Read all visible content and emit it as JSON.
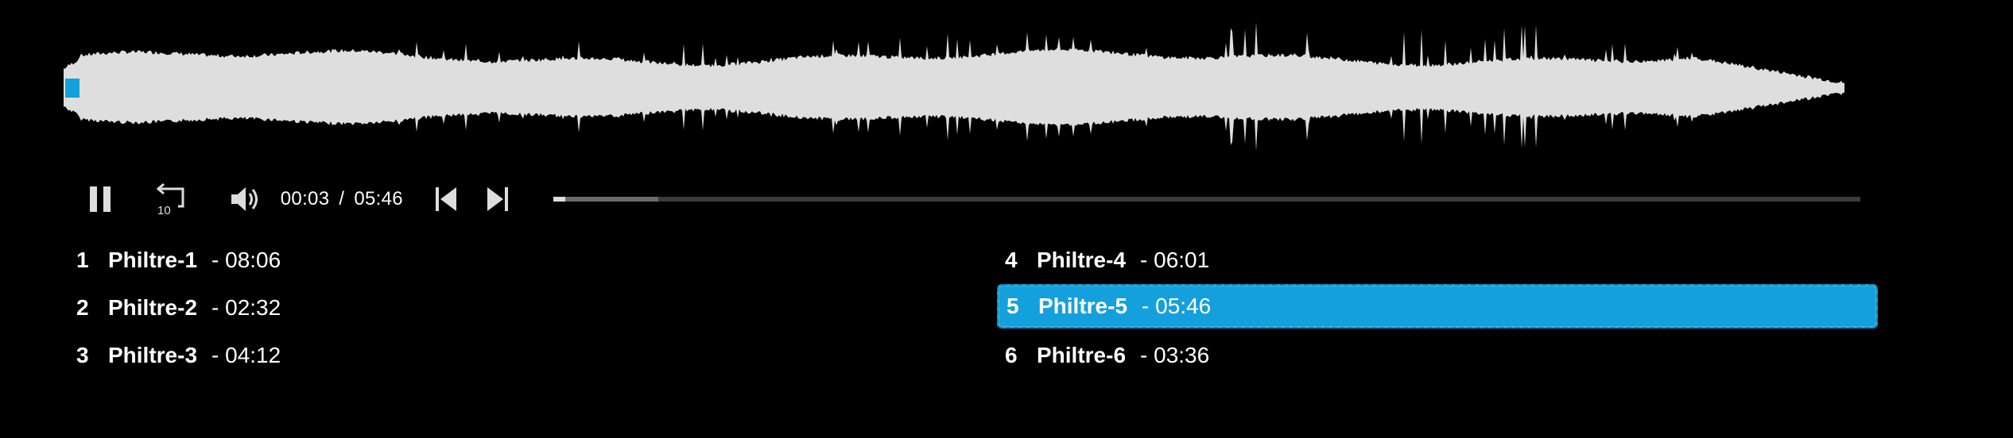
{
  "colors": {
    "background": "#000000",
    "waveform": "#dedede",
    "accent": "#14a0dc",
    "text": "#ffffff"
  },
  "controls": {
    "pause_icon": "pause-icon",
    "replay_icon": "replay-10-icon",
    "replay_label": "10",
    "volume_icon": "volume-icon",
    "current_time": "00:03",
    "separator": "/",
    "total_time": "05:46",
    "prev_icon": "skip-previous-icon",
    "next_icon": "skip-next-icon",
    "progress_played_fraction": 0.009,
    "progress_buffered_fraction": 0.08
  },
  "playlist": {
    "active_index": 4,
    "tracks": [
      {
        "num": "1",
        "name": "Philtre-1",
        "dur": "- 08:06"
      },
      {
        "num": "2",
        "name": "Philtre-2",
        "dur": "- 02:32"
      },
      {
        "num": "3",
        "name": "Philtre-3",
        "dur": "- 04:12"
      },
      {
        "num": "4",
        "name": "Philtre-4",
        "dur": "- 06:01"
      },
      {
        "num": "5",
        "name": "Philtre-5",
        "dur": "- 05:46"
      },
      {
        "num": "6",
        "name": "Philtre-6",
        "dur": "- 03:36"
      }
    ]
  }
}
